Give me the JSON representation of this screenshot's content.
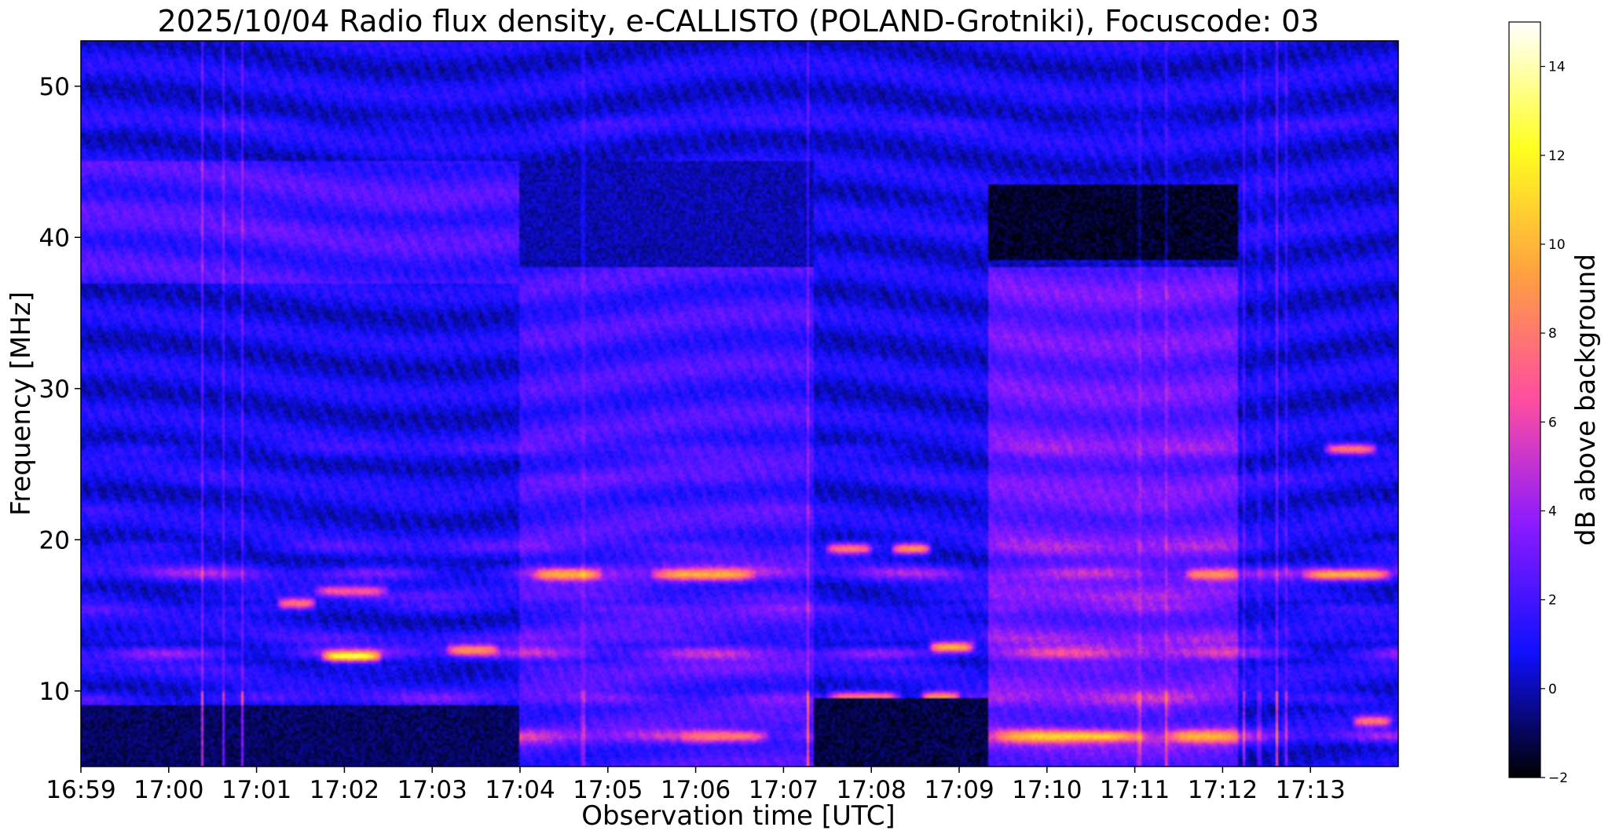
{
  "chart_data": {
    "type": "heatmap",
    "title": "2025/10/04  Radio flux density, e-CALLISTO (POLAND-Grotniki), Focuscode: 03",
    "xlabel": "Observation time [UTC]",
    "ylabel": "Frequency [MHz]",
    "x_ticks": [
      "16:59",
      "17:00",
      "17:01",
      "17:02",
      "17:03",
      "17:04",
      "17:05",
      "17:06",
      "17:07",
      "17:08",
      "17:09",
      "17:10",
      "17:11",
      "17:12",
      "17:13"
    ],
    "x_range": [
      "16:59",
      "17:14"
    ],
    "y_ticks": [
      10,
      20,
      30,
      40,
      50
    ],
    "ylim": [
      5,
      53
    ],
    "colorbar": {
      "label": "dB above background",
      "ticks": [
        -2,
        0,
        2,
        4,
        6,
        8,
        10,
        12,
        14
      ],
      "range": [
        -2,
        15
      ],
      "colormap": "gnuplot2",
      "colors": [
        "#000000",
        "#1010ff",
        "#8a1aff",
        "#ff4da0",
        "#ffa040",
        "#ffff20",
        "#ffffff"
      ]
    },
    "background_level_db": 1.2,
    "bands_mhz": [
      {
        "freq": 47.5,
        "level": 2.5
      },
      {
        "freq": 42.0,
        "level": 2.0
      },
      {
        "freq": 40.5,
        "level": 1.8
      },
      {
        "freq": 26.0,
        "level": 3.0
      },
      {
        "freq": 24.0,
        "level": 2.2
      },
      {
        "freq": 22.0,
        "level": 2.0
      },
      {
        "freq": 19.5,
        "level": 3.5
      },
      {
        "freq": 17.8,
        "level": 6.5
      },
      {
        "freq": 16.2,
        "level": 3.0
      },
      {
        "freq": 15.5,
        "level": 3.5
      },
      {
        "freq": 13.5,
        "level": 3.0
      },
      {
        "freq": 12.5,
        "level": 7.0
      },
      {
        "freq": 11.5,
        "level": 2.5
      },
      {
        "freq": 9.5,
        "level": 4.5
      },
      {
        "freq": 7.0,
        "level": 8.0
      }
    ],
    "bright_events": [
      {
        "t_start": "17:01:45",
        "t_end": "17:02:25",
        "freq": 12.3,
        "level": 13
      },
      {
        "t_start": "17:01:15",
        "t_end": "17:01:40",
        "freq": 15.8,
        "level": 8
      },
      {
        "t_start": "17:01:40",
        "t_end": "17:02:30",
        "freq": 16.6,
        "level": 7
      },
      {
        "t_start": "17:03:10",
        "t_end": "17:03:45",
        "freq": 12.7,
        "level": 9
      },
      {
        "t_start": "17:04:10",
        "t_end": "17:04:55",
        "freq": 17.7,
        "level": 10
      },
      {
        "t_start": "17:05:30",
        "t_end": "17:06:40",
        "freq": 17.7,
        "level": 10
      },
      {
        "t_start": "17:07:30",
        "t_end": "17:08:00",
        "freq": 19.4,
        "level": 8
      },
      {
        "t_start": "17:08:15",
        "t_end": "17:08:40",
        "freq": 19.4,
        "level": 9
      },
      {
        "t_start": "17:07:30",
        "t_end": "17:08:20",
        "freq": 9.6,
        "level": 8
      },
      {
        "t_start": "17:08:35",
        "t_end": "17:09:00",
        "freq": 9.6,
        "level": 9
      },
      {
        "t_start": "17:08:40",
        "t_end": "17:09:10",
        "freq": 12.9,
        "level": 10
      },
      {
        "t_start": "17:09:25",
        "t_end": "17:11:10",
        "freq": 7.0,
        "level": 11
      },
      {
        "t_start": "17:11:25",
        "t_end": "17:12:10",
        "freq": 7.0,
        "level": 10
      },
      {
        "t_start": "17:11:35",
        "t_end": "17:12:10",
        "freq": 17.7,
        "level": 9
      },
      {
        "t_start": "17:12:55",
        "t_end": "17:13:55",
        "freq": 17.7,
        "level": 10
      },
      {
        "t_start": "17:13:10",
        "t_end": "17:13:45",
        "freq": 26.0,
        "level": 8
      },
      {
        "t_start": "17:13:30",
        "t_end": "17:13:55",
        "freq": 8.0,
        "level": 8
      },
      {
        "t_start": "17:05:50",
        "t_end": "17:06:50",
        "freq": 7.0,
        "level": 8
      }
    ],
    "dark_regions": [
      {
        "t_start": "17:09:20",
        "t_end": "17:12:10",
        "f_low": 38.5,
        "f_high": 43.5,
        "level": -1.8
      },
      {
        "t_start": "16:59:00",
        "t_end": "17:04:00",
        "f_low": 5.0,
        "f_high": 9.0,
        "level": -1.2
      },
      {
        "t_start": "17:07:20",
        "t_end": "17:09:20",
        "f_low": 5.0,
        "f_high": 9.5,
        "level": -1.5
      },
      {
        "t_start": "17:04:00",
        "t_end": "17:07:20",
        "f_low": 38.0,
        "f_high": 45.0,
        "level": -0.3
      }
    ],
    "enhanced_regions": [
      {
        "t_start": "17:09:20",
        "t_end": "17:12:10",
        "f_low": 5.0,
        "f_high": 38.0,
        "level": 2.8
      },
      {
        "t_start": "17:04:00",
        "t_end": "17:07:20",
        "f_low": 5.0,
        "f_high": 38.0,
        "level": 1.9
      },
      {
        "t_start": "16:59:00",
        "t_end": "17:04:00",
        "f_low": 37.0,
        "f_high": 45.0,
        "level": 2.0
      }
    ],
    "vertical_streaks": [
      "17:00:23",
      "17:00:37",
      "17:00:50",
      "17:04:43",
      "17:07:17",
      "17:11:03",
      "17:11:22",
      "17:12:15",
      "17:12:25",
      "17:12:37",
      "17:12:43"
    ]
  }
}
